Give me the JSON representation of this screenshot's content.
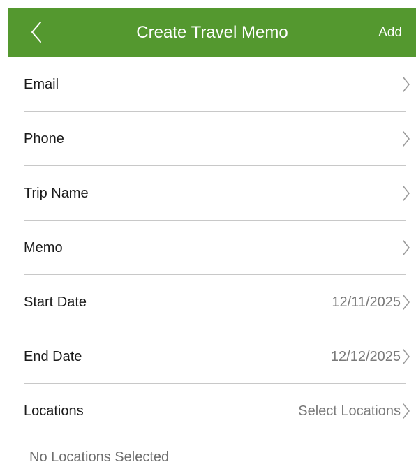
{
  "navbar": {
    "title": "Create Travel Memo",
    "add_label": "Add",
    "background_color": "#54982f",
    "back_icon": "chevron-left-icon"
  },
  "form": {
    "rows": [
      {
        "label": "Email",
        "value": ""
      },
      {
        "label": "Phone",
        "value": ""
      },
      {
        "label": "Trip Name",
        "value": ""
      },
      {
        "label": "Memo",
        "value": ""
      },
      {
        "label": "Start Date",
        "value": "12/11/2025"
      },
      {
        "label": "End Date",
        "value": "12/12/2025"
      },
      {
        "label": "Locations",
        "value": "Select Locations"
      }
    ],
    "chevron_icon": "chevron-right-icon"
  },
  "locations": {
    "empty_text": "No Locations Selected"
  }
}
